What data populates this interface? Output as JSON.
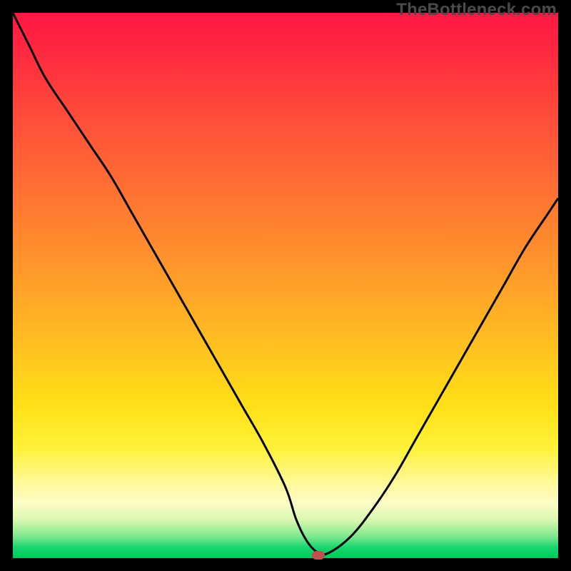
{
  "watermark": "TheBottleneck.com",
  "colors": {
    "top": "#ff1744",
    "mid_orange": "#ff8a2e",
    "mid_yellow": "#ffe017",
    "pale": "#fdfcc7",
    "green": "#00c85a",
    "curve": "#000000",
    "marker": "#c0504d",
    "frame": "#000000"
  },
  "chart_data": {
    "type": "line",
    "title": "",
    "xlabel": "",
    "ylabel": "",
    "xlim": [
      0,
      100
    ],
    "ylim": [
      0,
      100
    ],
    "series": [
      {
        "name": "bottleneck-curve",
        "x": [
          0,
          3,
          6,
          10,
          14,
          18,
          22,
          26,
          30,
          34,
          38,
          42,
          46,
          50,
          52,
          54,
          56,
          58,
          62,
          66,
          70,
          74,
          78,
          82,
          86,
          90,
          94,
          98,
          100
        ],
        "values": [
          100,
          94,
          88,
          82,
          76,
          70,
          63,
          56,
          49,
          42,
          35,
          28,
          21,
          13,
          7,
          3,
          1,
          1,
          4,
          9,
          15,
          22,
          29,
          36,
          43,
          50,
          57,
          63,
          66
        ]
      }
    ],
    "marker": {
      "x": 56,
      "y": 0.5
    },
    "gradient_axis": "vertical",
    "gradient_meaning": "red=high bottleneck, green=low bottleneck"
  }
}
